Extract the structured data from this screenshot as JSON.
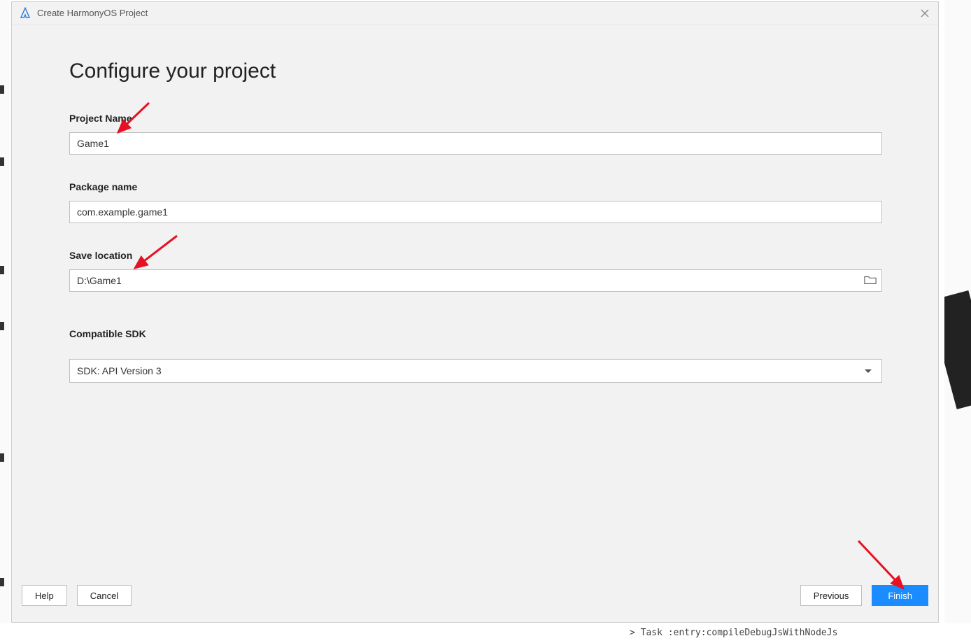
{
  "titlebar": {
    "title": "Create HarmonyOS Project"
  },
  "page": {
    "heading": "Configure your project"
  },
  "fields": {
    "projectName": {
      "label": "Project Name",
      "value": "Game1"
    },
    "packageName": {
      "label": "Package name",
      "value": "com.example.game1"
    },
    "saveLocation": {
      "label": "Save location",
      "value": "D:\\Game1"
    },
    "compatibleSdk": {
      "label": "Compatible SDK",
      "selected": "SDK: API Version 3"
    }
  },
  "footer": {
    "help": "Help",
    "cancel": "Cancel",
    "previous": "Previous",
    "finish": "Finish"
  },
  "background": {
    "statusLine": "> Task :entry:compileDebugJsWithNodeJs"
  }
}
